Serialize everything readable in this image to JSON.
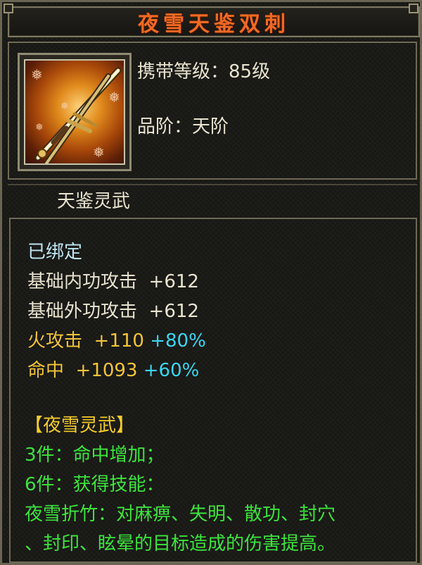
{
  "item": {
    "name": "夜雪天鉴双刺",
    "level_label": "携带等级：",
    "level_value": "85级",
    "grade_label": "品阶：",
    "grade_value": "天阶",
    "category": "天鉴灵武"
  },
  "attributes": {
    "bound": "已绑定",
    "base_lines": [
      {
        "label": "基础内功攻击",
        "value": "+612"
      },
      {
        "label": "基础外功攻击",
        "value": "+612"
      }
    ],
    "bonus_lines": [
      {
        "label": "火攻击",
        "value": "+110",
        "pct": "+80%"
      },
      {
        "label": "命中",
        "value": "+1093",
        "pct": "+60%"
      }
    ]
  },
  "set": {
    "name": "【夜雪灵武】",
    "effects": [
      "3件：命中增加；",
      "6件：获得技能：",
      "夜雪折竹：对麻痹、失明、散功、封穴",
      "、封印、眩晕的目标造成的伤害提高。"
    ]
  },
  "colors": {
    "title": "#ef6a24",
    "bound": "#bfe6f2",
    "bonus": "#f2c43a",
    "percent": "#39d6f0",
    "set_name": "#f4cc2c",
    "set_effect": "#3ce43c"
  },
  "icons": {
    "item_icon": "twin-daggers-icon",
    "decoration": "snowflake-icon"
  }
}
